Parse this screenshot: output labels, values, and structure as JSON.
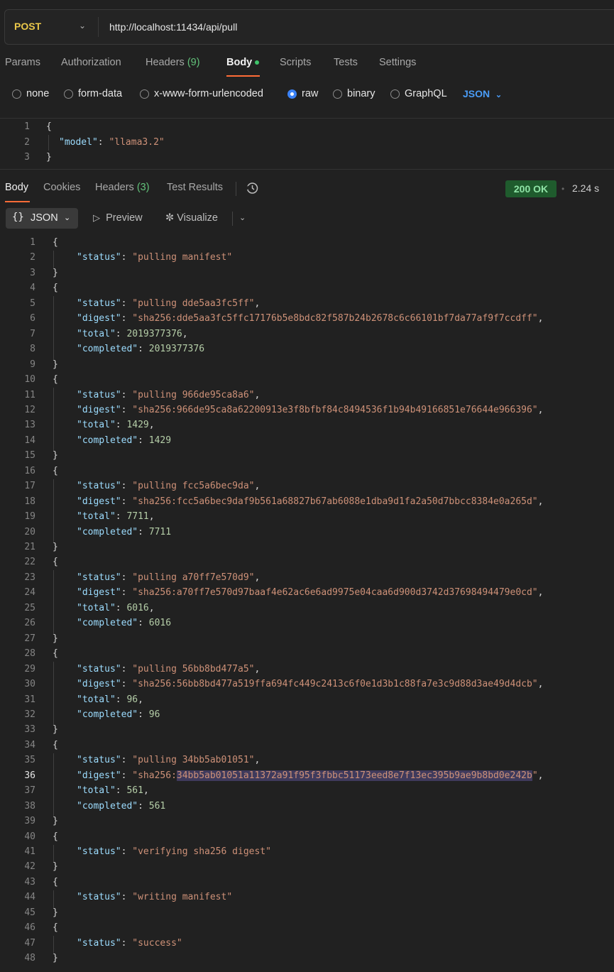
{
  "request": {
    "method": "POST",
    "url": "http://localhost:11434/api/pull",
    "tabs": [
      {
        "label": "Params"
      },
      {
        "label": "Authorization"
      },
      {
        "label": "Headers",
        "count": "(9)"
      },
      {
        "label": "Body",
        "active": true
      },
      {
        "label": "Scripts"
      },
      {
        "label": "Tests"
      },
      {
        "label": "Settings"
      }
    ],
    "body_types": [
      "none",
      "form-data",
      "x-www-form-urlencoded",
      "raw",
      "binary",
      "GraphQL"
    ],
    "selected_body_type": "raw",
    "format": "JSON",
    "body_lines": [
      "1",
      "2",
      "3"
    ],
    "body_key": "\"model\"",
    "body_value": "\"llama3.2\""
  },
  "response": {
    "tabs": [
      {
        "label": "Body",
        "active": true
      },
      {
        "label": "Cookies"
      },
      {
        "label": "Headers",
        "count": "(3)"
      },
      {
        "label": "Test Results"
      }
    ],
    "status": "200 OK",
    "time": "2.24 s",
    "view_format": "JSON",
    "preview_label": "Preview",
    "visualize_label": "Visualize",
    "lines": [
      {
        "n": "1",
        "t": "open"
      },
      {
        "n": "2",
        "t": "kv",
        "k": "\"status\"",
        "v": "\"pulling manifest\"",
        "vt": "str"
      },
      {
        "n": "3",
        "t": "close"
      },
      {
        "n": "4",
        "t": "open"
      },
      {
        "n": "5",
        "t": "kv",
        "k": "\"status\"",
        "v": "\"pulling dde5aa3fc5ff\"",
        "vt": "str",
        "c": true
      },
      {
        "n": "6",
        "t": "kv",
        "k": "\"digest\"",
        "v": "\"sha256:dde5aa3fc5ffc17176b5e8bdc82f587b24b2678c6c66101bf7da77af9f7ccdff\"",
        "vt": "str",
        "c": true
      },
      {
        "n": "7",
        "t": "kv",
        "k": "\"total\"",
        "v": "2019377376",
        "vt": "num",
        "c": true
      },
      {
        "n": "8",
        "t": "kv",
        "k": "\"completed\"",
        "v": "2019377376",
        "vt": "num"
      },
      {
        "n": "9",
        "t": "close"
      },
      {
        "n": "10",
        "t": "open"
      },
      {
        "n": "11",
        "t": "kv",
        "k": "\"status\"",
        "v": "\"pulling 966de95ca8a6\"",
        "vt": "str",
        "c": true
      },
      {
        "n": "12",
        "t": "kv",
        "k": "\"digest\"",
        "v": "\"sha256:966de95ca8a62200913e3f8bfbf84c8494536f1b94b49166851e76644e966396\"",
        "vt": "str",
        "c": true
      },
      {
        "n": "13",
        "t": "kv",
        "k": "\"total\"",
        "v": "1429",
        "vt": "num",
        "c": true
      },
      {
        "n": "14",
        "t": "kv",
        "k": "\"completed\"",
        "v": "1429",
        "vt": "num"
      },
      {
        "n": "15",
        "t": "close"
      },
      {
        "n": "16",
        "t": "open"
      },
      {
        "n": "17",
        "t": "kv",
        "k": "\"status\"",
        "v": "\"pulling fcc5a6bec9da\"",
        "vt": "str",
        "c": true
      },
      {
        "n": "18",
        "t": "kv",
        "k": "\"digest\"",
        "v": "\"sha256:fcc5a6bec9daf9b561a68827b67ab6088e1dba9d1fa2a50d7bbcc8384e0a265d\"",
        "vt": "str",
        "c": true
      },
      {
        "n": "19",
        "t": "kv",
        "k": "\"total\"",
        "v": "7711",
        "vt": "num",
        "c": true
      },
      {
        "n": "20",
        "t": "kv",
        "k": "\"completed\"",
        "v": "7711",
        "vt": "num"
      },
      {
        "n": "21",
        "t": "close"
      },
      {
        "n": "22",
        "t": "open"
      },
      {
        "n": "23",
        "t": "kv",
        "k": "\"status\"",
        "v": "\"pulling a70ff7e570d9\"",
        "vt": "str",
        "c": true
      },
      {
        "n": "24",
        "t": "kv",
        "k": "\"digest\"",
        "v": "\"sha256:a70ff7e570d97baaf4e62ac6e6ad9975e04caa6d900d3742d37698494479e0cd\"",
        "vt": "str",
        "c": true
      },
      {
        "n": "25",
        "t": "kv",
        "k": "\"total\"",
        "v": "6016",
        "vt": "num",
        "c": true
      },
      {
        "n": "26",
        "t": "kv",
        "k": "\"completed\"",
        "v": "6016",
        "vt": "num"
      },
      {
        "n": "27",
        "t": "close"
      },
      {
        "n": "28",
        "t": "open"
      },
      {
        "n": "29",
        "t": "kv",
        "k": "\"status\"",
        "v": "\"pulling 56bb8bd477a5\"",
        "vt": "str",
        "c": true
      },
      {
        "n": "30",
        "t": "kv",
        "k": "\"digest\"",
        "v": "\"sha256:56bb8bd477a519ffa694fc449c2413c6f0e1d3b1c88fa7e3c9d88d3ae49d4dcb\"",
        "vt": "str",
        "c": true
      },
      {
        "n": "31",
        "t": "kv",
        "k": "\"total\"",
        "v": "96",
        "vt": "num",
        "c": true
      },
      {
        "n": "32",
        "t": "kv",
        "k": "\"completed\"",
        "v": "96",
        "vt": "num"
      },
      {
        "n": "33",
        "t": "close"
      },
      {
        "n": "34",
        "t": "open"
      },
      {
        "n": "35",
        "t": "kv",
        "k": "\"status\"",
        "v": "\"pulling 34bb5ab01051\"",
        "vt": "str",
        "c": true
      },
      {
        "n": "36",
        "t": "digest-sel",
        "k": "\"digest\"",
        "v1": "\"sha256:",
        "v2": "34bb5ab01051a11372a91f95f3fbbc51173eed8e7f13ec395b9ae9b8bd0e242b",
        "v3": "\"",
        "c": true
      },
      {
        "n": "37",
        "t": "kv",
        "k": "\"total\"",
        "v": "561",
        "vt": "num",
        "c": true
      },
      {
        "n": "38",
        "t": "kv",
        "k": "\"completed\"",
        "v": "561",
        "vt": "num"
      },
      {
        "n": "39",
        "t": "close"
      },
      {
        "n": "40",
        "t": "open"
      },
      {
        "n": "41",
        "t": "kv",
        "k": "\"status\"",
        "v": "\"verifying sha256 digest\"",
        "vt": "str"
      },
      {
        "n": "42",
        "t": "close"
      },
      {
        "n": "43",
        "t": "open"
      },
      {
        "n": "44",
        "t": "kv",
        "k": "\"status\"",
        "v": "\"writing manifest\"",
        "vt": "str"
      },
      {
        "n": "45",
        "t": "close"
      },
      {
        "n": "46",
        "t": "open"
      },
      {
        "n": "47",
        "t": "kv",
        "k": "\"status\"",
        "v": "\"success\"",
        "vt": "str"
      },
      {
        "n": "48",
        "t": "close"
      }
    ]
  }
}
